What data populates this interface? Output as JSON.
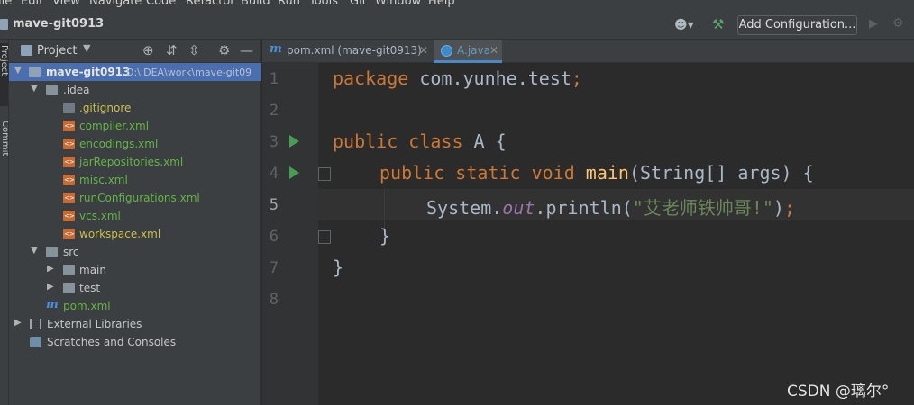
{
  "menu": [
    "ile",
    "Edit",
    "View",
    "Navigate",
    "Code",
    "Refactor",
    "Build",
    "Run",
    "Tools",
    "Git",
    "Window",
    "Help"
  ],
  "toolbar": {
    "project_name": "mave-git0913",
    "add_configuration": "Add Configuration..."
  },
  "left_strip": {
    "project_label": "Project",
    "commit_label": "Commit"
  },
  "project_panel": {
    "title": "Project",
    "tree": [
      {
        "label": "mave-git0913",
        "path": "D:\\IDEA\\work\\mave-git09"
      },
      {
        "label": ".idea"
      },
      {
        "label": ".gitignore"
      },
      {
        "label": "compiler.xml"
      },
      {
        "label": "encodings.xml"
      },
      {
        "label": "jarRepositories.xml"
      },
      {
        "label": "misc.xml"
      },
      {
        "label": "runConfigurations.xml"
      },
      {
        "label": "vcs.xml"
      },
      {
        "label": "workspace.xml"
      },
      {
        "label": "src"
      },
      {
        "label": "main"
      },
      {
        "label": "test"
      },
      {
        "label": "pom.xml"
      },
      {
        "label": "External Libraries"
      },
      {
        "label": "Scratches and Consoles"
      }
    ]
  },
  "tabs": [
    {
      "label": "pom.xml (mave-git0913)"
    },
    {
      "label": "A.java"
    }
  ],
  "editor": {
    "line_numbers": [
      "1",
      "2",
      "3",
      "4",
      "5",
      "6",
      "7",
      "8"
    ],
    "current_line": "5",
    "code": {
      "l1_kw": "package",
      "l1_rest": " com.yunhe.test",
      "l1_semi": ";",
      "l3_kw": "public class",
      "l3_rest": " A {",
      "l4_kw": "public static void",
      "l4_fn": " main",
      "l4_rest": "(String[] args) {",
      "l5_a": "System.",
      "l5_field": "out",
      "l5_b": ".println(",
      "l5_str": "\"艾老师铁帅哥!\"",
      "l5_c": ")",
      "l5_semi": ";",
      "l6": "}",
      "l7": "}"
    }
  },
  "watermark": "CSDN @璃尔°"
}
